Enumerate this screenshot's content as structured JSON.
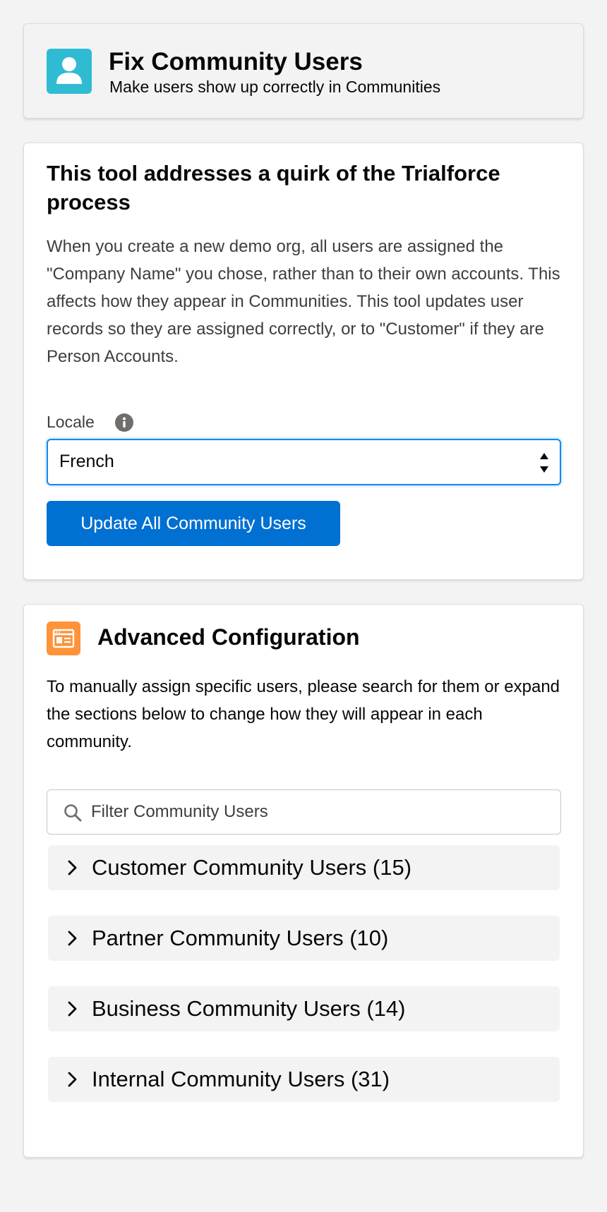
{
  "header": {
    "title": "Fix Community Users",
    "subtitle": "Make users show up correctly in Communities",
    "icon": "user-icon",
    "icon_color": "#2fbcd2"
  },
  "tool": {
    "heading": "This tool addresses a quirk of the Trialforce process",
    "description": "When you create a new demo org, all users are assigned the \"Company Name\" you chose, rather than to their own accounts. This affects how they appear in Communities. This tool updates user records so they are assigned correctly, or to \"Customer\" if they are Person Accounts.",
    "locale_label": "Locale",
    "locale_info_icon": "info-icon",
    "locale_value": "French",
    "update_button_label": "Update All Community Users",
    "button_color": "#0070d2"
  },
  "advanced": {
    "title": "Advanced Configuration",
    "icon": "contact-card-icon",
    "icon_color": "#fe9339",
    "description": "To manually assign specific users, please search for them or expand the sections below to change how they will appear in each community.",
    "filter_placeholder": "Filter Community Users",
    "filter_value": "",
    "sections": [
      {
        "label": "Customer Community Users (15)"
      },
      {
        "label": "Partner Community Users (10)"
      },
      {
        "label": "Business Community Users (14)"
      },
      {
        "label": "Internal Community Users (31)"
      }
    ]
  }
}
